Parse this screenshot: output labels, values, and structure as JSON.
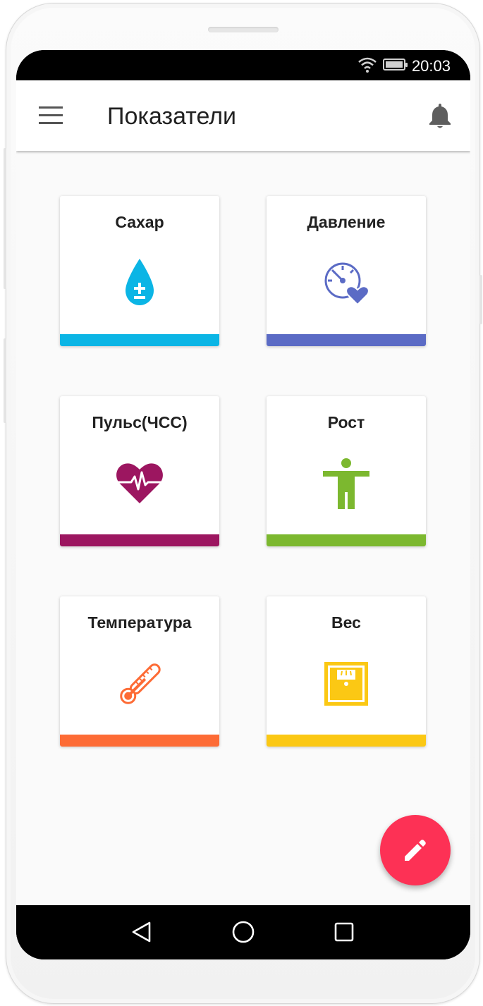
{
  "status_bar": {
    "time": "20:03",
    "wifi_icon": "wifi-icon",
    "battery_icon": "battery-icon"
  },
  "app_bar": {
    "title": "Показатели",
    "menu_icon": "hamburger-menu-icon",
    "notification_icon": "bell-icon"
  },
  "cards": [
    {
      "label": "Сахар",
      "icon": "blood-drop-plus-minus-icon",
      "color": "#0bb5e5"
    },
    {
      "label": "Давление",
      "icon": "gauge-heart-icon",
      "color": "#5b6bc5"
    },
    {
      "label": "Пульс(ЧСС)",
      "icon": "heart-pulse-icon",
      "color": "#9c1660"
    },
    {
      "label": "Рост",
      "icon": "person-standing-icon",
      "color": "#7cb82f"
    },
    {
      "label": "Температура",
      "icon": "thermometer-icon",
      "color": "#fd6b35"
    },
    {
      "label": "Вес",
      "icon": "scale-icon",
      "color": "#fbc814"
    }
  ],
  "fab": {
    "icon": "pencil-icon",
    "color": "#fd3155"
  },
  "nav_bar": {
    "back_icon": "back-triangle-icon",
    "home_icon": "home-circle-icon",
    "recents_icon": "recents-square-icon"
  }
}
